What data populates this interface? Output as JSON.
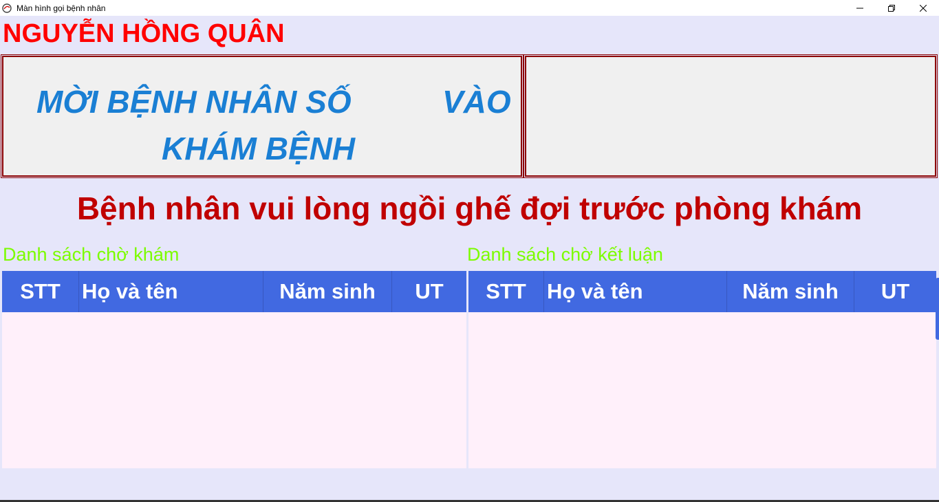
{
  "window": {
    "title": "Màn hình gọi bệnh nhân",
    "controls": [
      "minimize",
      "restore",
      "close"
    ]
  },
  "doctor_name": "NGUYỄN HỒNG QUÂN",
  "call_panel": {
    "line1": "MỜI BỆNH NHÂN SỐ",
    "line1_end": "VÀO",
    "line2": "KHÁM BỆNH"
  },
  "notice": "Bệnh nhân vui lòng ngồi ghế đợi trước phòng khám",
  "lists": {
    "waiting_exam": {
      "label": "Danh sách chờ khám",
      "columns": [
        "STT",
        "Họ và tên",
        "Năm sinh",
        "UT"
      ],
      "rows": []
    },
    "waiting_conclusion": {
      "label": "Danh sách chờ kết luận",
      "columns": [
        "STT",
        "Họ và tên",
        "Năm sinh",
        "UT"
      ],
      "rows": []
    }
  },
  "colors": {
    "background": "#e6e6fa",
    "doctor_name": "#ff0000",
    "call_text": "#1a7fd4",
    "notice": "#c00000",
    "list_label": "#7cfc00",
    "grid_header": "#4169e1",
    "grid_body": "#fff0fa",
    "panel_border": "#8b0000"
  }
}
